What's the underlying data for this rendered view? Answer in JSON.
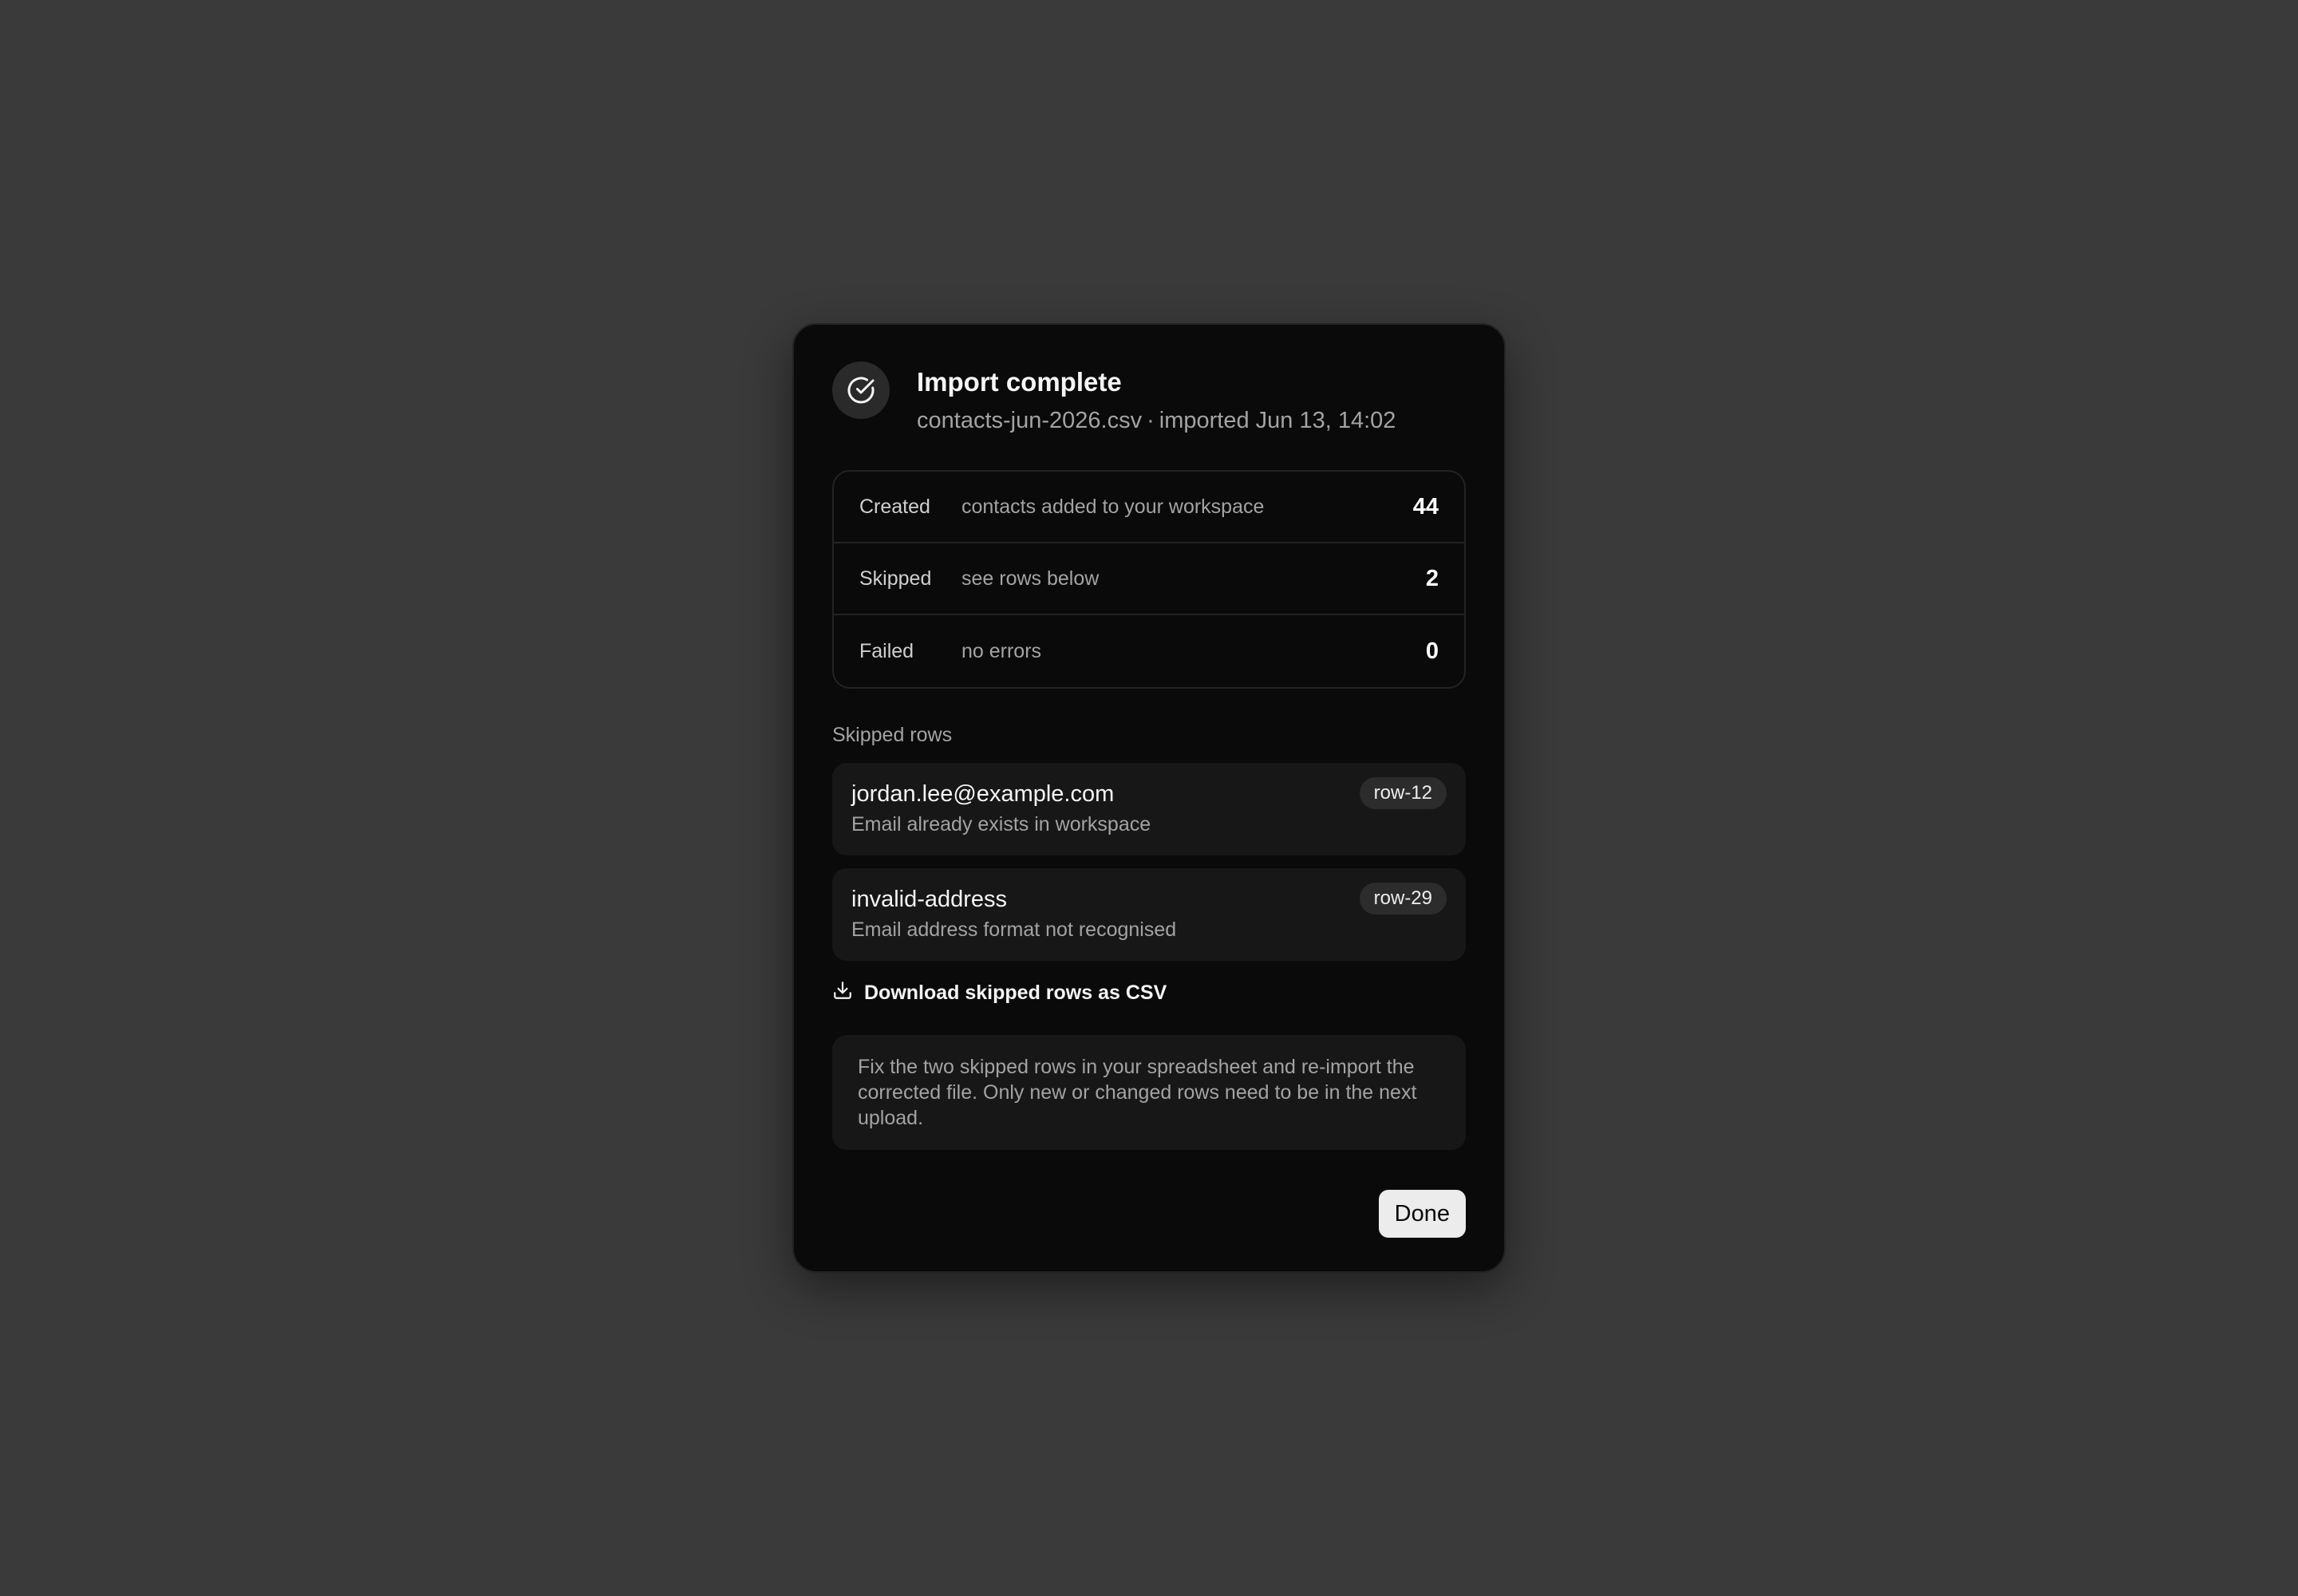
{
  "dialog": {
    "title": "Import complete",
    "file_name": "contacts-jun-2026.csv",
    "separator": "·",
    "imported_at": "imported Jun 13, 14:02",
    "icon": "check-circle-icon"
  },
  "stats": [
    {
      "label": "Created",
      "description": "contacts added to your workspace",
      "value": "44"
    },
    {
      "label": "Skipped",
      "description": "see rows below",
      "value": "2"
    },
    {
      "label": "Failed",
      "description": "no errors",
      "value": "0"
    }
  ],
  "skipped": {
    "section_label": "Skipped rows",
    "rows": [
      {
        "value": "jordan.lee@example.com",
        "reason": "Email already exists in workspace",
        "row": "row-12"
      },
      {
        "value": "invalid-address",
        "reason": "Email address format not recognised",
        "row": "row-29"
      }
    ],
    "download_label": "Download skipped rows as CSV",
    "download_icon": "download-icon"
  },
  "note": "Fix the two skipped rows in your spreadsheet and re-import the corrected file. Only new or changed rows need to be in the next upload.",
  "footer": {
    "done_label": "Done"
  },
  "colors": {
    "background": "#3a3a3a",
    "dialog": "#0a0a0a",
    "surface": "#171717",
    "button": "#ececec"
  }
}
